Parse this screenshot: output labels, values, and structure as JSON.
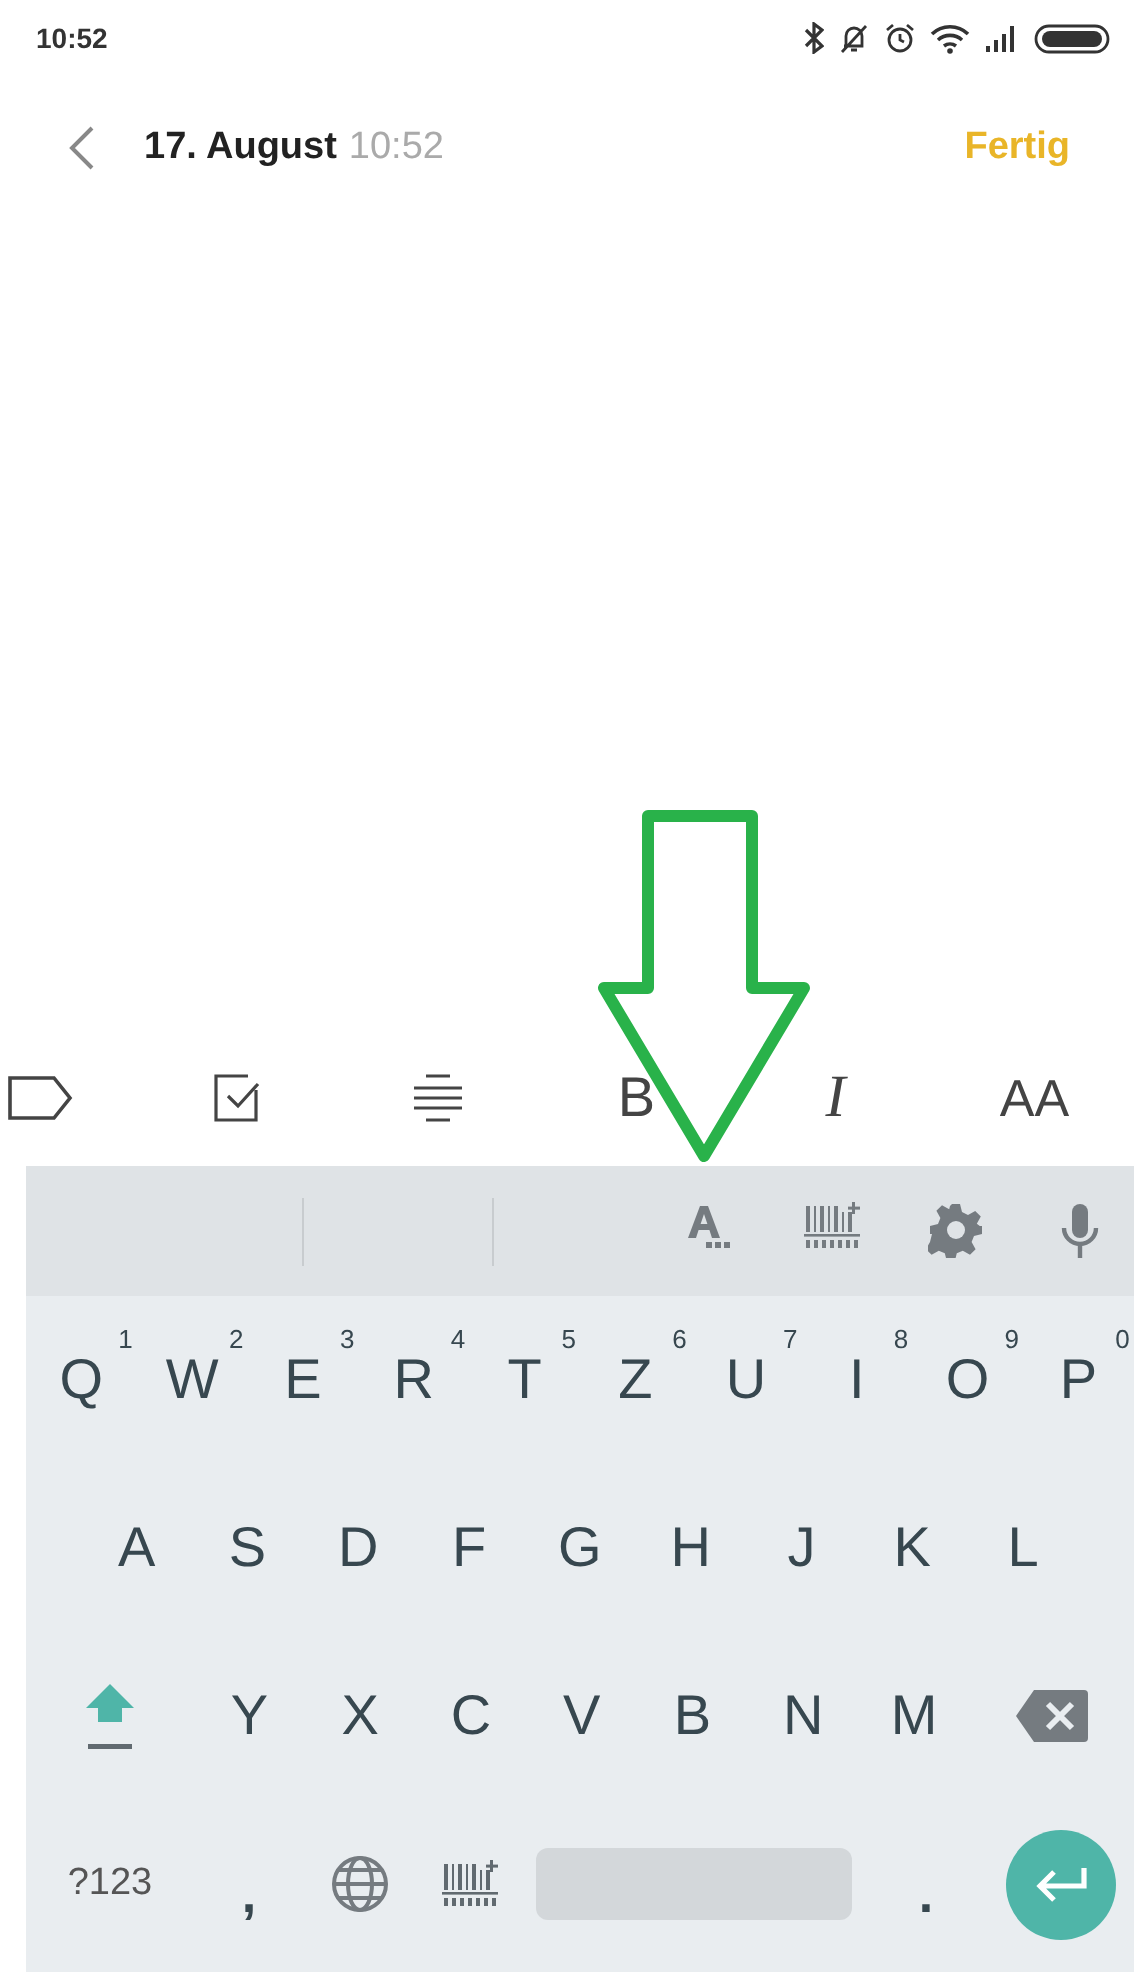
{
  "status_bar": {
    "time": "10:52"
  },
  "header": {
    "date": "17. August",
    "time": "10:52",
    "done_button": "Fertig"
  },
  "format_toolbar": [
    {
      "kind": "tag"
    },
    {
      "kind": "checkbox"
    },
    {
      "kind": "align"
    },
    {
      "kind": "bold",
      "label": "B"
    },
    {
      "kind": "italic",
      "label": "I"
    },
    {
      "kind": "size",
      "label": "AA"
    }
  ],
  "keyboard": {
    "suggestion_tools": [
      {
        "kind": "text-style"
      },
      {
        "kind": "barcode"
      },
      {
        "kind": "settings"
      },
      {
        "kind": "mic"
      }
    ],
    "rows": [
      [
        {
          "label": "Q",
          "hint": "1"
        },
        {
          "label": "W",
          "hint": "2"
        },
        {
          "label": "E",
          "hint": "3"
        },
        {
          "label": "R",
          "hint": "4"
        },
        {
          "label": "T",
          "hint": "5"
        },
        {
          "label": "Z",
          "hint": "6"
        },
        {
          "label": "U",
          "hint": "7"
        },
        {
          "label": "I",
          "hint": "8"
        },
        {
          "label": "O",
          "hint": "9"
        },
        {
          "label": "P",
          "hint": "0"
        }
      ],
      [
        {
          "label": "A"
        },
        {
          "label": "S"
        },
        {
          "label": "D"
        },
        {
          "label": "F"
        },
        {
          "label": "G"
        },
        {
          "label": "H"
        },
        {
          "label": "J"
        },
        {
          "label": "K"
        },
        {
          "label": "L"
        }
      ],
      [
        {
          "label": "Y"
        },
        {
          "label": "X"
        },
        {
          "label": "C"
        },
        {
          "label": "V"
        },
        {
          "label": "B"
        },
        {
          "label": "N"
        },
        {
          "label": "M"
        }
      ]
    ],
    "shift": {
      "on": true
    },
    "bottom_row": [
      {
        "kind": "symbols",
        "label": "?123"
      },
      {
        "kind": "char",
        "label": ","
      },
      {
        "kind": "globe"
      },
      {
        "kind": "barcode"
      },
      {
        "kind": "space"
      },
      {
        "kind": "char",
        "label": "."
      },
      {
        "kind": "enter"
      }
    ]
  },
  "annotation": {
    "kind": "arrow"
  }
}
